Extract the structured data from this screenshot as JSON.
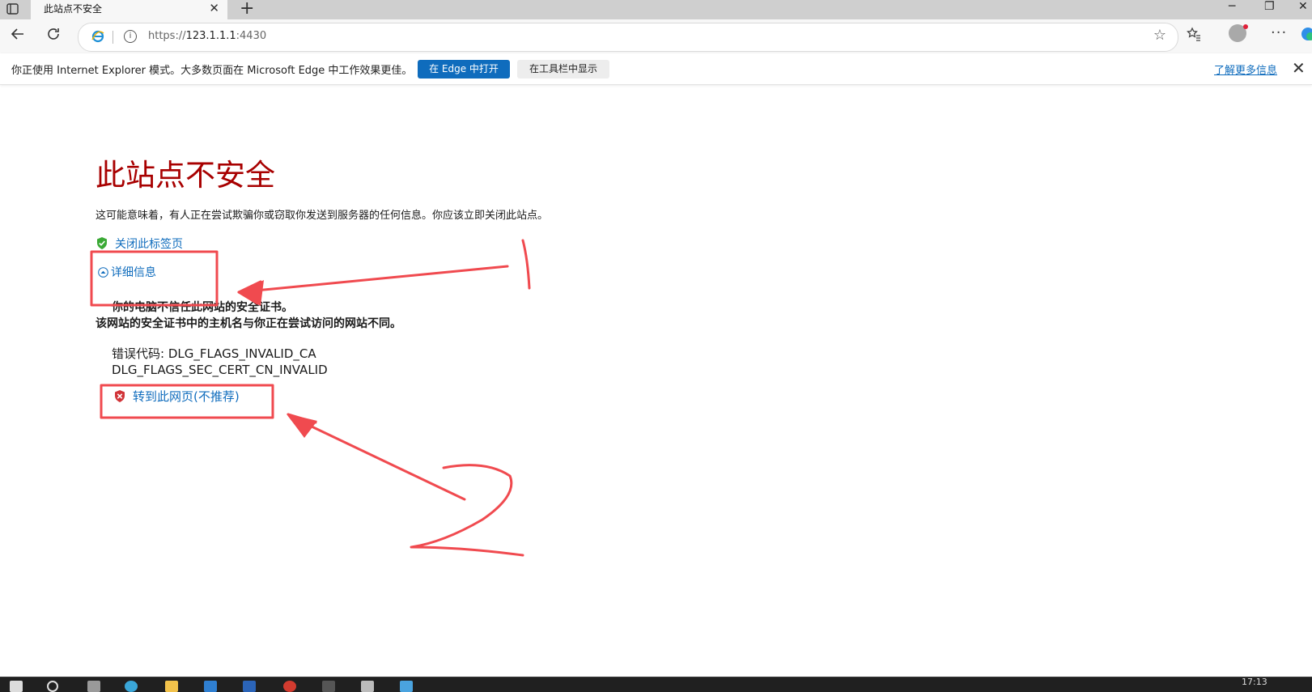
{
  "browser": {
    "tab_title": "此站点不安全",
    "new_tab_glyph": "+",
    "url_scheme": "https://",
    "url_host": "123.1.1.1",
    "url_port": ":4430"
  },
  "ie_mode_bar": {
    "message": "你正使用 Internet Explorer 模式。大多数页面在 Microsoft Edge 中工作效果更佳。",
    "open_in_edge_label": "在 Edge 中打开",
    "show_in_toolbar_label": "在工具栏中显示",
    "learn_more_label": "了解更多信息"
  },
  "page": {
    "title": "此站点不安全",
    "description": "这可能意味着，有人正在尝试欺骗你或窃取你发送到服务器的任何信息。你应该立即关闭此站点。",
    "close_tab_label": "关闭此标签页",
    "details_label": "详细信息",
    "details_line1": "你的电脑不信任此网站的安全证书。",
    "details_line2": "该网站的安全证书中的主机名与你正在尝试访问的网站不同。",
    "error_code_line1": "错误代码: DLG_FLAGS_INVALID_CA",
    "error_code_line2": "DLG_FLAGS_SEC_CERT_CN_INVALID",
    "proceed_label": "转到此网页(不推荐)"
  },
  "taskbar": {
    "clock": "17:13"
  },
  "colors": {
    "title_red": "#a80000",
    "link_blue": "#0f6cbd",
    "annotation_red": "#f04a4f"
  }
}
